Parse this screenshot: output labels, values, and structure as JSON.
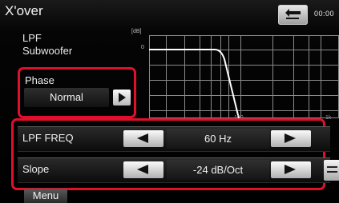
{
  "header": {
    "title": "X'over",
    "clock": "00:00",
    "back_icon": "return-arrow-icon"
  },
  "graph": {
    "label_line1": "LPF",
    "label_line2": "Subwoofer",
    "db_unit": "[dB]",
    "zero_label": "0",
    "tick_100": "100",
    "tick_1k": "1k"
  },
  "phase": {
    "title": "Phase",
    "value": "Normal"
  },
  "lpf_freq": {
    "label": "LPF FREQ",
    "value": "60 Hz"
  },
  "slope": {
    "label": "Slope",
    "value": "-24 dB/Oct"
  },
  "menu": {
    "label": "Menu"
  },
  "colors": {
    "highlight": "#e0102d"
  }
}
